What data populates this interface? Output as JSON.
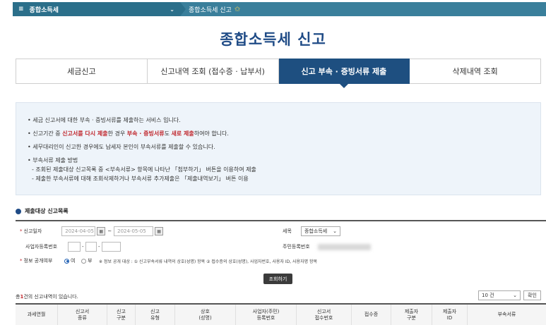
{
  "topbar": {
    "menu_icon": "hamburger-icon",
    "menu_label": "종합소득세",
    "crumb": "종합소득세 신고",
    "star_icon": "star-icon"
  },
  "title": "종합소득세 신고",
  "tabs": [
    {
      "label": "세금신고"
    },
    {
      "label": "신고내역 조회 (접수증 · 납부서)"
    },
    {
      "label": "신고 부속 · 증빙서류 제출"
    },
    {
      "label": "삭제내역 조회"
    }
  ],
  "info": {
    "l1": "세금 신고서에 대한 부속 · 증빙서류를 제출하는 서비스 입니다.",
    "l2_a": "신고기간 중 ",
    "l2_b": "신고서를 다시 제출",
    "l2_c": "한 경우 ",
    "l2_d": "부속 · 증빙서류",
    "l2_e": "도 ",
    "l2_f": "새로 제출",
    "l2_g": "하여야 합니다.",
    "l3": "세무대리인이 신고한 경우에도 납세자 본인이 부속서류를 제출할 수 있습니다.",
    "l4": "부속서류 제출 방법",
    "l5": "- 조회된 제출대상 신고목록 중 <부속서류> 항목에 나타난 「첨부하기」 버튼을 이용하여 제출",
    "l6": "- 제출한 부속서류에 대해 조회삭제하거나 부속서류 추가제출은 「제출내역보기」 버튼 이용"
  },
  "section": {
    "title": "제출대상 신고목록"
  },
  "form": {
    "period_label": "신고일자",
    "date_from": "2024-04-05",
    "date_sep": "~",
    "date_to": "2024-05-05",
    "tax_label": "세목",
    "tax_value": "종합소득세",
    "bizno_label": "사업자등록번호",
    "dash": "-",
    "resno_label": "주민등록번호",
    "disclose_label": "정보 공개여부",
    "yes": "여",
    "no": "부",
    "note": "※ 정보 공개 대상 : ① 신고부속서류 내역의 상호(성명) 항목 ② 접수증의 상호(성명), 사업자번호, 사용자 ID, 사용자명 항목"
  },
  "search_button": "조회하기",
  "result": {
    "count_prefix": "총",
    "count_value": "1",
    "count_suffix": "건의 신고내역이 있습니다.",
    "per_page": "10 건",
    "confirm": "확인"
  },
  "table": {
    "headers": [
      "과세연월",
      "신고서\n종류",
      "신고\n구분",
      "신고\n유형",
      "상호\n(성명)",
      "사업자(주민)\n등록번호",
      "신고서\n접수번호",
      "접수증",
      "제출자\n구분",
      "제출자\nID",
      "부속서류"
    ]
  },
  "colors": {
    "accent": "#1e4f80",
    "topbar": "#2b6f8a",
    "highlight": "#c0272d"
  }
}
